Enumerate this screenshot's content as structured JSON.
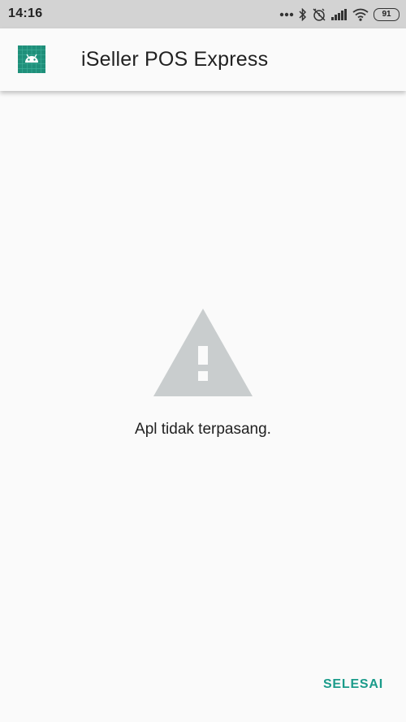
{
  "status_bar": {
    "time": "14:16",
    "battery": "91",
    "icons": [
      "more-dots-icon",
      "bluetooth-icon",
      "alarm-off-icon",
      "signal-icon",
      "wifi-icon",
      "battery-icon"
    ]
  },
  "app_bar": {
    "app_icon": "android-app-icon",
    "title": "iSeller POS Express"
  },
  "content": {
    "icon": "warning-triangle-icon",
    "message": "Apl tidak terpasang."
  },
  "actions": {
    "done_label": "SELESAI"
  },
  "colors": {
    "accent": "#1a9b8a",
    "app_icon_bg": "#1f8f7a",
    "warning_icon": "#c9cdce",
    "background": "#fafafa",
    "status_bar": "#d3d3d3"
  }
}
